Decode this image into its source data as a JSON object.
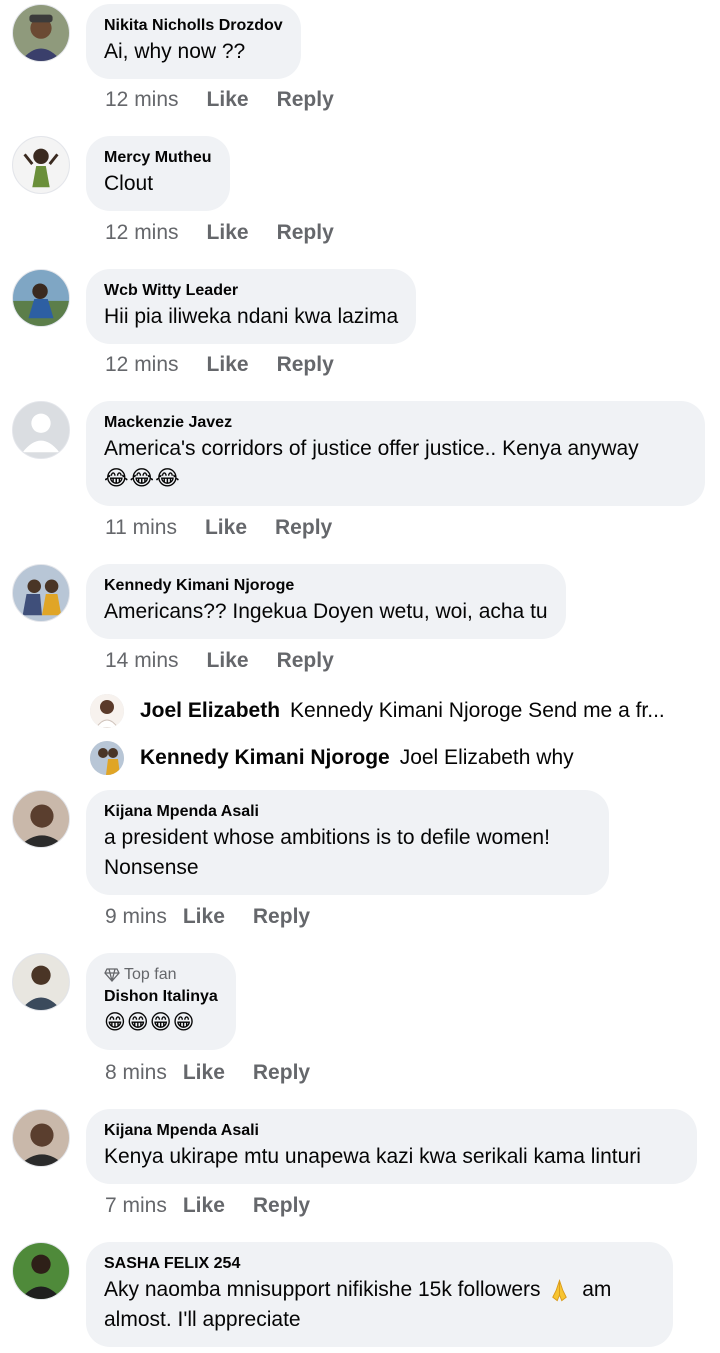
{
  "comments": [
    {
      "author": "Nikita Nicholls Drozdov",
      "text": "Ai, why now ??",
      "time": "12 mins"
    },
    {
      "author": "Mercy Mutheu",
      "text": "Clout",
      "time": "12 mins"
    },
    {
      "author": "Wcb Witty Leader",
      "text": "Hii pia iliweka ndani kwa lazima",
      "time": "12 mins"
    },
    {
      "author": "Mackenzie Javez",
      "text": "America's corridors of justice offer justice.. Kenya anyway",
      "emoji_line": "😂😂😂",
      "time": "11 mins"
    },
    {
      "author": "Kennedy Kimani Njoroge",
      "text": "Americans?? Ingekua Doyen wetu, woi, acha tu",
      "time": "14 mins"
    },
    {
      "author": "Kijana Mpenda Asali",
      "text_line1": "a president whose ambitions is to defile women!",
      "text_line2": "Nonsense",
      "time": "9 mins"
    },
    {
      "badge": "Top fan",
      "author": "Dishon Italinya",
      "emoji_line": "😁😁😁😁",
      "time": "8 mins"
    },
    {
      "author": "Kijana Mpenda Asali",
      "text": "Kenya ukirape mtu unapewa kazi kwa serikali kama linturi",
      "time": "7 mins"
    },
    {
      "author": "SASHA FELIX 254",
      "text_line1": "Aky naomba mnisupport nifikishe 15k followers",
      "text_line1_end": "am",
      "text_line2": "almost. I'll appreciate"
    }
  ],
  "replies": [
    {
      "author": "Joel Elizabeth",
      "text": "Kennedy Kimani Njoroge Send me a fr..."
    },
    {
      "author": "Kennedy Kimani Njoroge",
      "text": "Joel Elizabeth why"
    }
  ],
  "actions": {
    "like": "Like",
    "reply": "Reply"
  },
  "icons": {
    "top_fan": "diamond-icon",
    "pray": "folded-hands-emoji"
  },
  "colors": {
    "bubble": "#f0f2f5",
    "meta": "#65676b",
    "text": "#050505"
  }
}
